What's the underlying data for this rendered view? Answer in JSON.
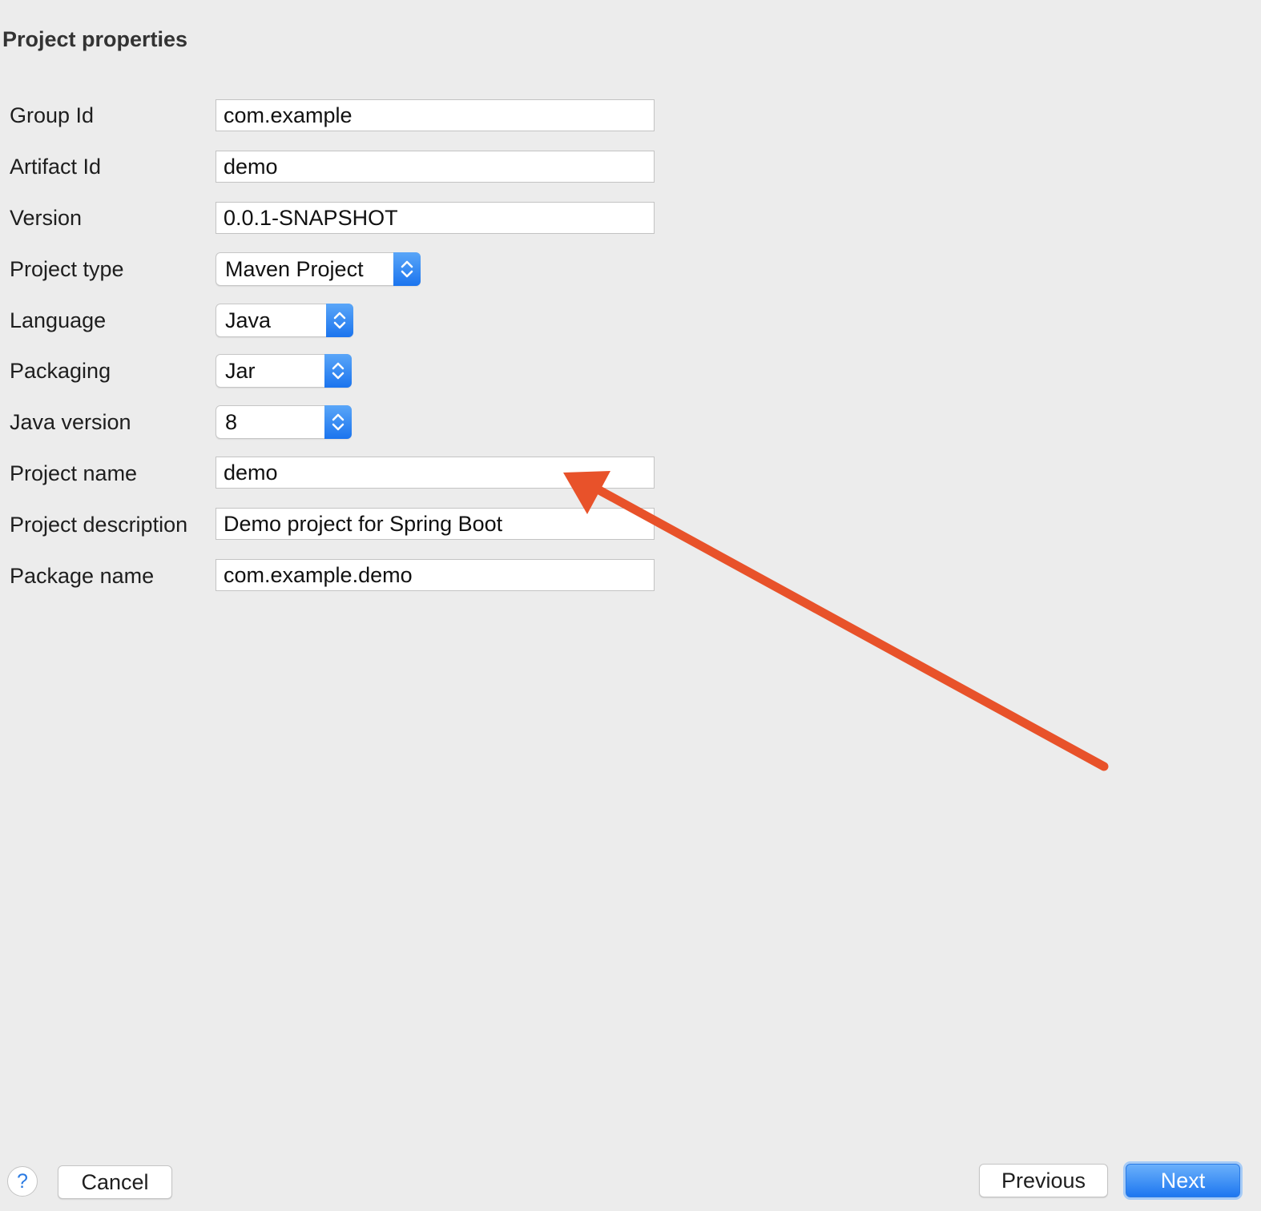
{
  "header": {
    "title": "Project properties"
  },
  "fields": {
    "group_id": {
      "label": "Group Id",
      "value": "com.example"
    },
    "artifact_id": {
      "label": "Artifact Id",
      "value": "demo"
    },
    "version": {
      "label": "Version",
      "value": "0.0.1-SNAPSHOT"
    },
    "project_type": {
      "label": "Project type",
      "value": "Maven Project"
    },
    "language": {
      "label": "Language",
      "value": "Java"
    },
    "packaging": {
      "label": "Packaging",
      "value": "Jar"
    },
    "java_version": {
      "label": "Java version",
      "value": "8"
    },
    "project_name": {
      "label": "Project name",
      "value": "demo"
    },
    "project_description": {
      "label": "Project description",
      "value": "Demo project for Spring Boot"
    },
    "package_name": {
      "label": "Package name",
      "value": "com.example.demo"
    }
  },
  "footer": {
    "help_label": "?",
    "cancel_label": "Cancel",
    "previous_label": "Previous",
    "next_label": "Next"
  },
  "annotation": {
    "arrow_color": "#e8522a",
    "target": "project-name-field"
  },
  "colors": {
    "accent": "#1d77f0",
    "background": "#ececec"
  }
}
